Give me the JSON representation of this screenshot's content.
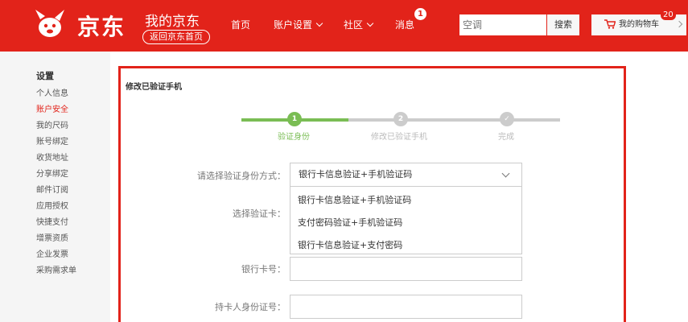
{
  "header": {
    "logo_text": "京东",
    "title": "我的京东",
    "back_home": "返回京东首页",
    "nav": [
      {
        "label": "首页"
      },
      {
        "label": "账户设置"
      },
      {
        "label": "社区"
      },
      {
        "label": "消息"
      }
    ],
    "message_count": "1",
    "search_placeholder": "空调",
    "search_button": "搜索",
    "cart_label": "我的购物车",
    "cart_count": "20",
    "brand_color": "#e2231a"
  },
  "sidebar": {
    "title": "设置",
    "items": [
      {
        "label": "个人信息"
      },
      {
        "label": "账户安全"
      },
      {
        "label": "我的尺码"
      },
      {
        "label": "账号绑定"
      },
      {
        "label": "收货地址"
      },
      {
        "label": "分享绑定"
      },
      {
        "label": "邮件订阅"
      },
      {
        "label": "应用授权"
      },
      {
        "label": "快捷支付"
      },
      {
        "label": "增票资质"
      },
      {
        "label": "企业发票"
      },
      {
        "label": "采购需求单"
      }
    ]
  },
  "main": {
    "title": "修改已验证手机",
    "steps": [
      {
        "num": "1",
        "label": "验证身份"
      },
      {
        "num": "2",
        "label": "修改已验证手机"
      },
      {
        "num": "✓",
        "label": "完成"
      }
    ],
    "form": {
      "method_label": "请选择验证身份方式：",
      "method_value": "银行卡信息验证+手机验证码",
      "options": [
        "银行卡信息验证+手机验证码",
        "支付密码验证+手机验证码",
        "银行卡信息验证+支付密码"
      ],
      "card_select_label": "选择验证卡：",
      "card_number_label": "银行卡号：",
      "holder_id_label": "持卡人身份证号："
    },
    "accent_green": "#7abd54"
  }
}
